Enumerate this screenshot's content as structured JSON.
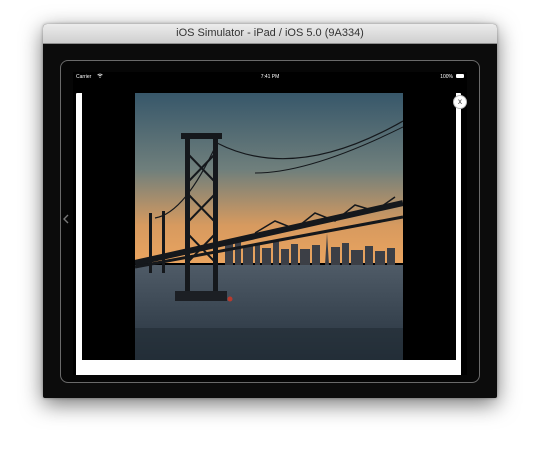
{
  "window": {
    "title": "iOS Simulator - iPad / iOS 5.0 (9A334)"
  },
  "status_bar": {
    "carrier": "Carrier",
    "time": "7:41 PM",
    "battery": "100%"
  },
  "lightbox": {
    "close_label": "x",
    "photo_subject": "bay-bridge-sunset-photo"
  },
  "colors": {
    "sky_top": "#3a5a6e",
    "sky_horizon": "#e7a25e",
    "water": "#2c3a47",
    "bridge": "#1a1d22"
  },
  "icons": {
    "wifi": "wifi-icon",
    "battery": "battery-icon",
    "close": "close-icon",
    "side_arrow": "chevron-left-icon"
  }
}
